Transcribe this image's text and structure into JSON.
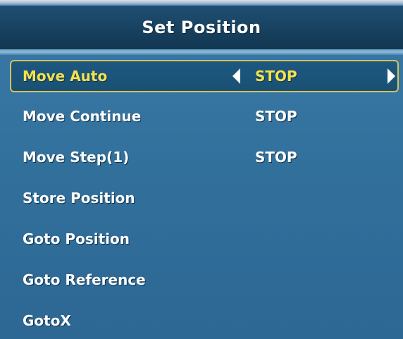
{
  "window": {
    "title": "Set Position"
  },
  "menu": {
    "items": [
      {
        "label": "Move Auto",
        "value": "STOP",
        "selected": true
      },
      {
        "label": "Move Continue",
        "value": "STOP",
        "selected": false
      },
      {
        "label": "Move Step(1)",
        "value": "STOP",
        "selected": false
      },
      {
        "label": "Store Position",
        "value": "",
        "selected": false
      },
      {
        "label": "Goto Position",
        "value": "",
        "selected": false
      },
      {
        "label": "Goto Reference",
        "value": "",
        "selected": false
      },
      {
        "label": "GotoX",
        "value": "",
        "selected": false
      }
    ]
  },
  "icons": {
    "left_arrow": "arrow-left-icon",
    "right_arrow": "arrow-right-icon"
  },
  "colors": {
    "background": "#32709c",
    "title_bar": "#17405e",
    "highlight_border": "#d4c35a",
    "selected_text": "#f3e24f",
    "text": "#ffffff"
  }
}
